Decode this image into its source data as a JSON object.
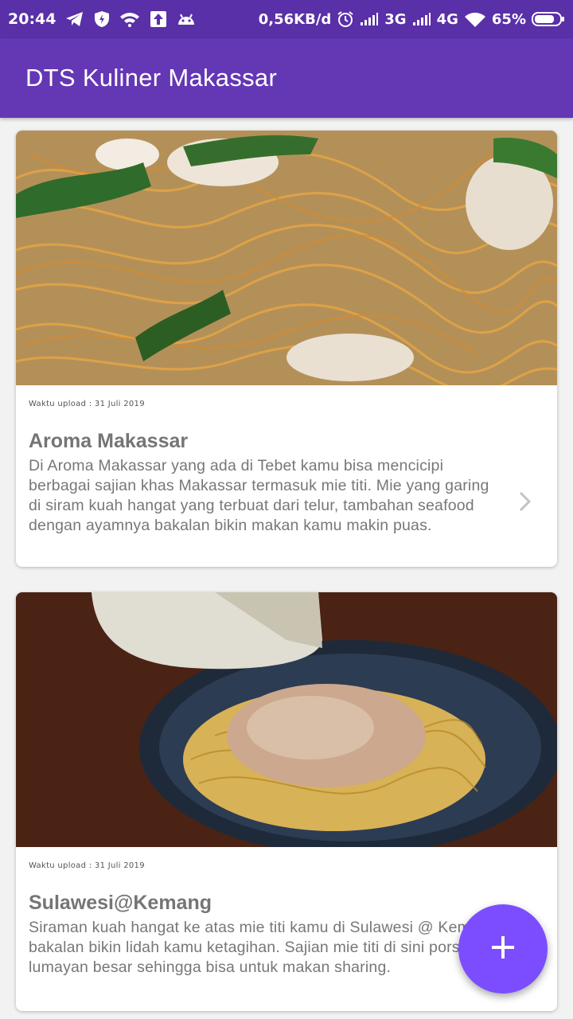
{
  "status_bar": {
    "time": "20:44",
    "net_speed": "0,56KB/d",
    "net_3g": "3G",
    "net_4g": "4G",
    "battery": "65%",
    "left_icons": [
      "telegram-icon",
      "shield-icon",
      "wifi-question-icon",
      "upload-icon",
      "android-icon"
    ],
    "right_icons": [
      "alarm-icon",
      "signal-icon",
      "signal-icon",
      "wifi-icon",
      "battery-icon"
    ]
  },
  "app_bar": {
    "title": "DTS Kuliner Makassar",
    "color": "#6437b5"
  },
  "cards": [
    {
      "upload_label": "Waktu upload :",
      "upload_date": "31 Juli 2019",
      "title": "Aroma Makassar",
      "description": "Di Aroma Makassar yang ada di Tebet kamu bisa mencicipi berbagai sajian khas Makassar termasuk mie titi. Mie yang garing di siram kuah hangat yang terbuat dari telur, tambahan seafood dengan ayamnya bakalan bikin makan kamu makin puas."
    },
    {
      "upload_label": "Waktu upload :",
      "upload_date": "31 Juli 2019",
      "title": "Sulawesi@Kemang",
      "description": "Siraman kuah hangat ke atas mie titi kamu di Sulawesi @ Kemang bakalan bikin lidah kamu ketagihan. Sajian mie titi di sini porsinya lumayan besar sehingga bisa untuk makan sharing."
    }
  ],
  "fab": {
    "icon": "plus-icon",
    "color": "#7c4dff"
  }
}
